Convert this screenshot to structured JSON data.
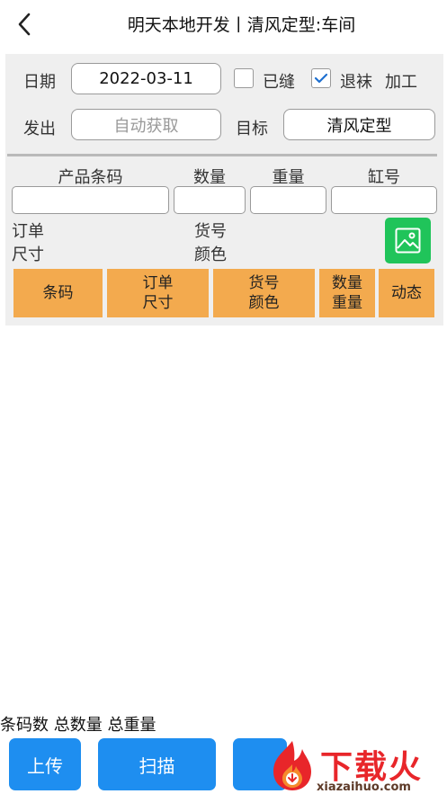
{
  "header": {
    "title": "明天本地开发丨清风定型:车间"
  },
  "form": {
    "date_label": "日期",
    "date_value": "2022-03-11",
    "sewn_label": "已缝",
    "sewn_checked": false,
    "return_label": "退袜",
    "return_checked": true,
    "process_label": "加工",
    "send_label": "发出",
    "send_placeholder": "自动获取",
    "target_label": "目标",
    "target_value": "清风定型"
  },
  "columns": {
    "barcode": "产品条码",
    "quantity": "数量",
    "weight": "重量",
    "vat": "缸号"
  },
  "info": {
    "order": "订单",
    "size": "尺寸",
    "item_no": "货号",
    "color": "颜色"
  },
  "tabs": [
    {
      "line1": "条码",
      "line2": ""
    },
    {
      "line1": "订单",
      "line2": "尺寸"
    },
    {
      "line1": "货号",
      "line2": "颜色"
    },
    {
      "line1": "数量",
      "line2": "重量"
    },
    {
      "line1": "动态",
      "line2": ""
    }
  ],
  "summary": {
    "text": "条码数 总数量 总重量"
  },
  "bottom": {
    "upload": "上传",
    "scan": "扫描"
  },
  "watermark": {
    "text": "下载火",
    "url": "xiazaihuo.com"
  },
  "colors": {
    "accent_blue": "#1e8ef0",
    "tab_orange": "#f3aa4e",
    "image_green": "#20c45a",
    "panel_gray": "#efefef",
    "watermark_red": "#e8262a"
  },
  "icons": {
    "back": "chevron-left-icon",
    "checkbox_check": "check-icon",
    "image": "image-icon"
  }
}
